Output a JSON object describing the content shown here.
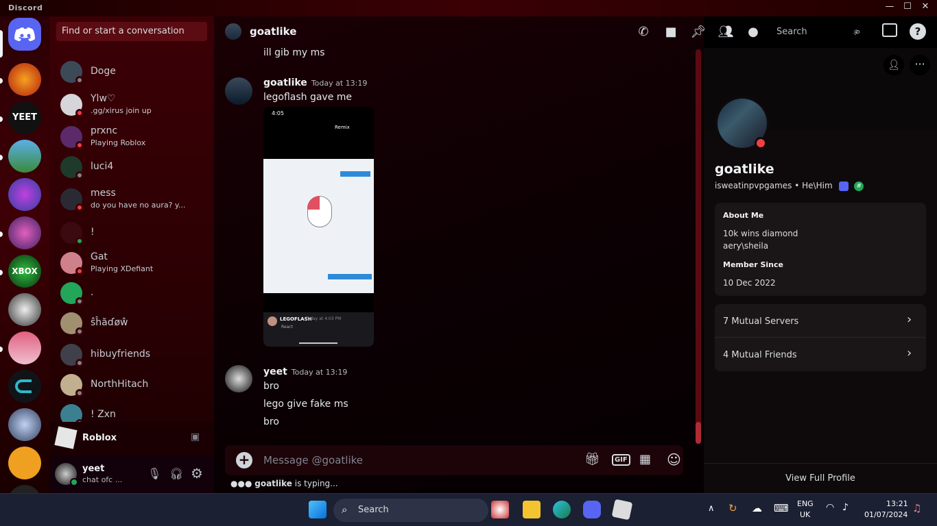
{
  "app": {
    "brand": "Discord",
    "win_min": "—",
    "win_max": "☐",
    "win_close": "✕"
  },
  "dm_search": {
    "placeholder": "Find or start a conversation"
  },
  "dms": [
    {
      "name": "Doge",
      "sub": "",
      "status": "offline",
      "color": "#3c4a58"
    },
    {
      "name": "Ylw♡",
      "sub": ".gg/xirus join up",
      "status": "dnd",
      "color": "#d6d6da"
    },
    {
      "name": "prxnc",
      "sub": "Playing Roblox",
      "status": "dnd",
      "color": "#5a2a6a"
    },
    {
      "name": "luci4",
      "sub": "",
      "status": "offline",
      "color": "#1e3a2a"
    },
    {
      "name": "mess",
      "sub": "do you have no aura? y...",
      "status": "dnd",
      "color": "#2a2a34"
    },
    {
      "name": "!",
      "sub": "",
      "status": "online",
      "color": "#3a0a10"
    },
    {
      "name": "Gat",
      "sub": "Playing XDefiant",
      "status": "dnd",
      "color": "#d0808a"
    },
    {
      "name": ".",
      "sub": "",
      "status": "offline",
      "color": "#23a55a"
    },
    {
      "name": "ŝĥăɗøŵ",
      "sub": "",
      "status": "offline",
      "color": "#a09070"
    },
    {
      "name": "hibuyfriends",
      "sub": "",
      "status": "offline",
      "color": "#40404a"
    },
    {
      "name": "NorthHitach",
      "sub": "",
      "status": "offline",
      "color": "#c0b090"
    },
    {
      "name": "! Zxn",
      "sub": "",
      "status": "offline",
      "color": "#3a8090"
    }
  ],
  "roblox": {
    "label": "Roblox"
  },
  "user": {
    "name": "yeet",
    "status": "chat ofc ..."
  },
  "chat": {
    "title": "goatlike",
    "search_label": "Search",
    "prev_line": "ill gib my ms",
    "messages": [
      {
        "author": "goatlike",
        "time": "Today at 13:19",
        "lines": [
          "legoflash gave me"
        ]
      },
      {
        "author": "yeet",
        "time": "Today at 13:19",
        "lines": [
          "bro",
          "lego give fake ms",
          "bro"
        ]
      }
    ],
    "composer_placeholder": "Message @goatlike",
    "typing": "goatlike",
    "typing_suffix": "is typing...",
    "gif_label": "GIF"
  },
  "attachment": {
    "time": "4:05",
    "remix": "Remix",
    "footer_name": "LEGOFLASH",
    "footer_time": "Today at 4:03 PM",
    "react": "React"
  },
  "profile": {
    "name": "goatlike",
    "handle": "isweatinpvpgames",
    "pronouns": "He\\Him",
    "about_title": "About Me",
    "about_lines": [
      "10k wins diamond",
      "aery\\sheila"
    ],
    "member_title": "Member Since",
    "member_since": "10 Dec 2022",
    "mutual_servers": "7 Mutual Servers",
    "mutual_friends": "4 Mutual Friends",
    "full_profile": "View Full Profile"
  },
  "taskbar": {
    "search": "Search",
    "lang1": "ENG",
    "lang2": "UK",
    "time": "13:21",
    "date": "01/07/2024"
  },
  "colors": {
    "accent": "#5865f2",
    "dnd": "#f23f43",
    "online": "#23a55a",
    "offline": "#80848e"
  }
}
